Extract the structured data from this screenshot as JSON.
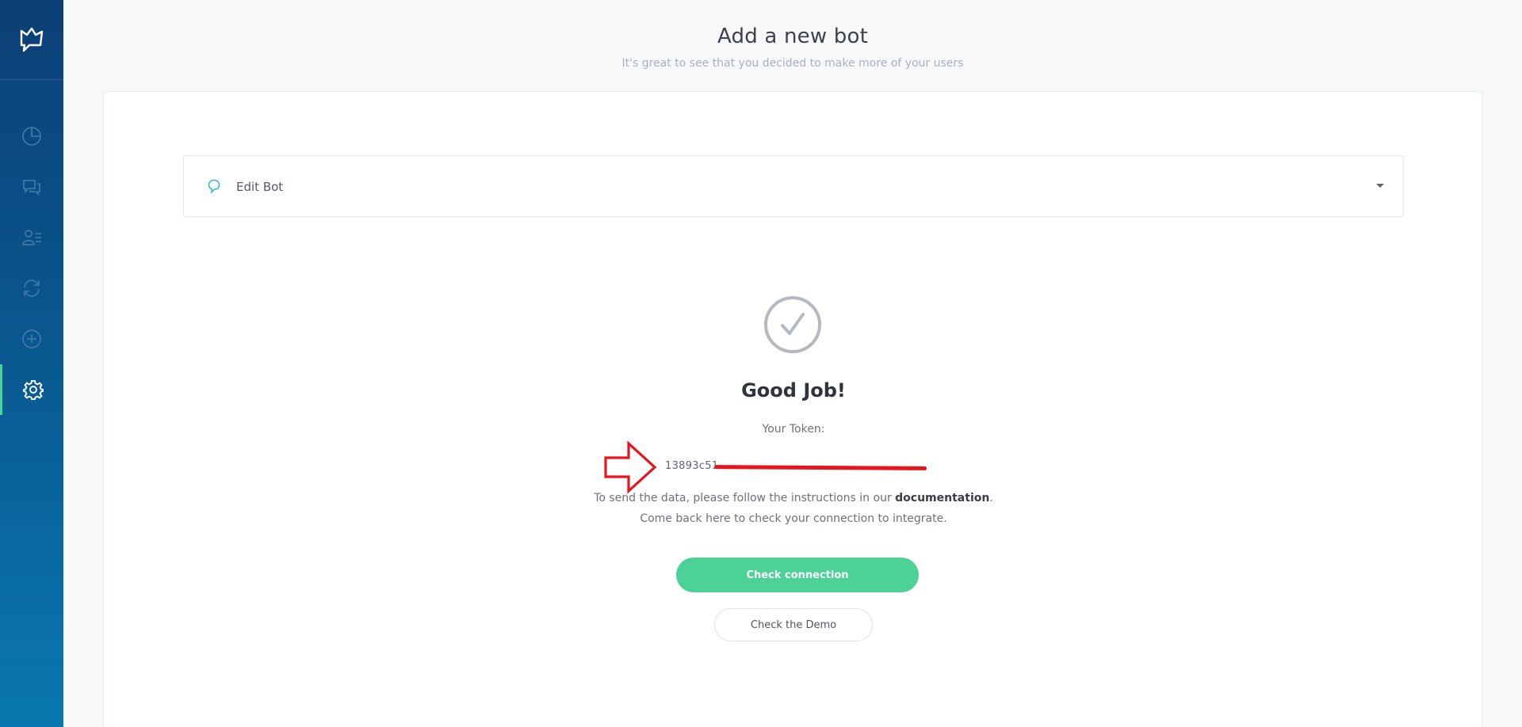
{
  "sidebar": {
    "logo_icon": "chat-bolt-logo-icon",
    "items": [
      {
        "icon": "pie-chart-icon",
        "active": false
      },
      {
        "icon": "chat-bubbles-icon",
        "active": false
      },
      {
        "icon": "users-list-icon",
        "active": false
      },
      {
        "icon": "refresh-icon",
        "active": false
      },
      {
        "icon": "plus-circle-icon",
        "active": false
      },
      {
        "icon": "gear-icon",
        "active": true
      }
    ],
    "active_color": "#4cd295"
  },
  "header": {
    "title": "Add a new bot",
    "subtitle": "It's great to see that you decided to make more of your users"
  },
  "accordion": {
    "icon": "chat-bubble-icon",
    "label": "Edit Bot"
  },
  "result": {
    "icon": "check-circle-icon",
    "heading": "Good Job!",
    "token_label": "Your Token:",
    "token_value": "13893c51",
    "instructions_line1_prefix": "To send the data, please follow the instructions in our ",
    "instructions_link": "documentation",
    "instructions_line1_suffix": ".",
    "instructions_line2": "Come back here to check your connection to integrate."
  },
  "buttons": {
    "check_connection": "Check connection",
    "check_demo": "Check the Demo"
  },
  "colors": {
    "primary_green": "#4cd297",
    "sidebar_top": "#0b3f75",
    "sidebar_bottom": "#0a78b0",
    "annotation_red": "#e8141c"
  }
}
